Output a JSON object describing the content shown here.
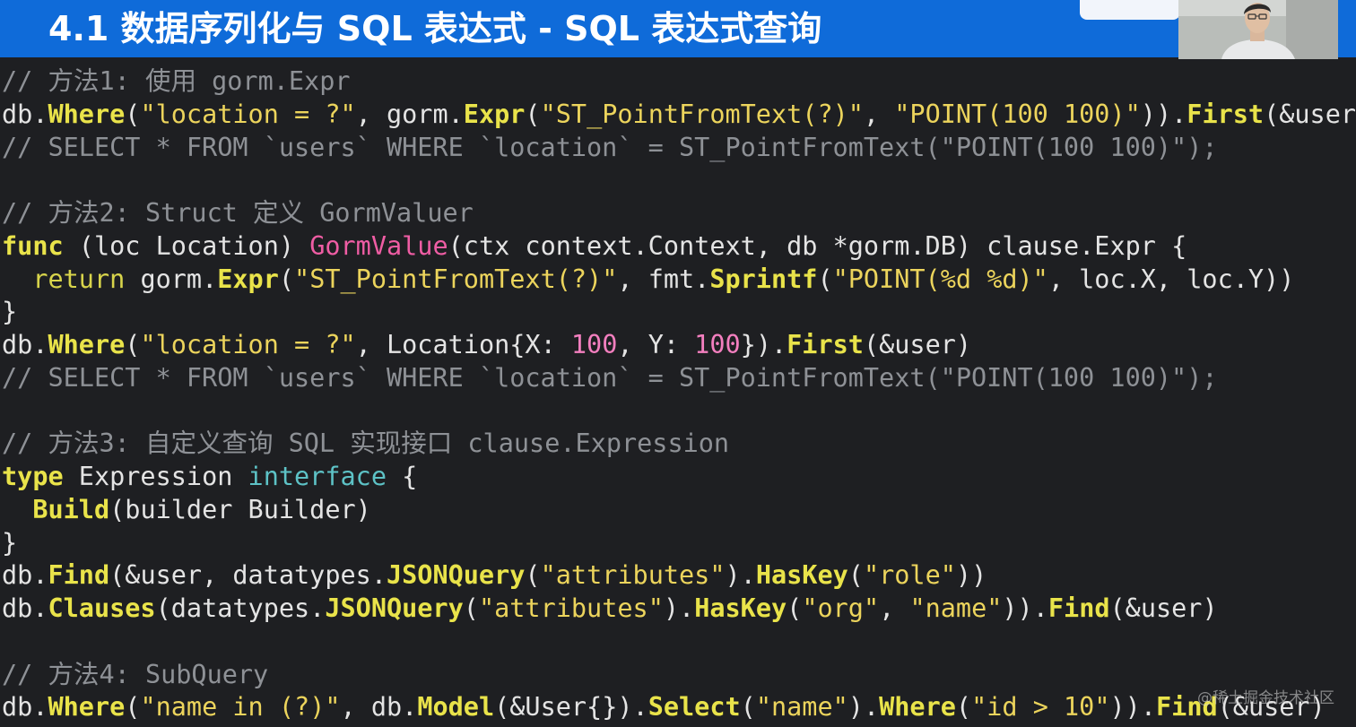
{
  "slide": {
    "title": "4.1 数据序列化与 SQL 表达式 - SQL 表达式查询"
  },
  "watermark": "@稀土掘金技术社区",
  "colors": {
    "title_bar": "#0f6bd9",
    "background": "#1e1f22",
    "comment": "#8e9196",
    "function_call": "#e9e34a",
    "string": "#ecd45c",
    "number": "#f37fbf",
    "type_keyword": "#5dc2c6",
    "method_name": "#ef5da4"
  },
  "code_lines": [
    [
      [
        "comment",
        "// 方法1: 使用 gorm.Expr"
      ]
    ],
    [
      [
        "plain",
        "db."
      ],
      [
        "call",
        "Where"
      ],
      [
        "plain",
        "("
      ],
      [
        "str",
        "\"location = ?\""
      ],
      [
        "plain",
        ", gorm."
      ],
      [
        "call",
        "Expr"
      ],
      [
        "plain",
        "("
      ],
      [
        "str",
        "\"ST_PointFromText(?)\""
      ],
      [
        "plain",
        ", "
      ],
      [
        "str",
        "\"POINT(100 100)\""
      ],
      [
        "plain",
        "))."
      ],
      [
        "call",
        "First"
      ],
      [
        "plain",
        "(&user)"
      ]
    ],
    [
      [
        "comment",
        "// SELECT * FROM `users` WHERE `location` = ST_PointFromText(\"POINT(100 100)\");"
      ]
    ],
    [],
    [
      [
        "comment",
        "// 方法2: Struct 定义 GormValuer"
      ]
    ],
    [
      [
        "keyword",
        "func"
      ],
      [
        "plain",
        " (loc Location) "
      ],
      [
        "method",
        "GormValue"
      ],
      [
        "plain",
        "(ctx context.Context, db *gorm.DB) clause.Expr {"
      ]
    ],
    [
      [
        "plain",
        "  "
      ],
      [
        "keyword2",
        "return"
      ],
      [
        "plain",
        " gorm."
      ],
      [
        "call",
        "Expr"
      ],
      [
        "plain",
        "("
      ],
      [
        "str",
        "\"ST_PointFromText(?)\""
      ],
      [
        "plain",
        ", fmt."
      ],
      [
        "call",
        "Sprintf"
      ],
      [
        "plain",
        "("
      ],
      [
        "str",
        "\"POINT(%d %d)\""
      ],
      [
        "plain",
        ", loc.X, loc.Y))"
      ]
    ],
    [
      [
        "plain",
        "}"
      ]
    ],
    [
      [
        "plain",
        "db."
      ],
      [
        "call",
        "Where"
      ],
      [
        "plain",
        "("
      ],
      [
        "str",
        "\"location = ?\""
      ],
      [
        "plain",
        ", Location{X: "
      ],
      [
        "num",
        "100"
      ],
      [
        "plain",
        ", Y: "
      ],
      [
        "num",
        "100"
      ],
      [
        "plain",
        "})."
      ],
      [
        "call",
        "First"
      ],
      [
        "plain",
        "(&user)"
      ]
    ],
    [
      [
        "comment",
        "// SELECT * FROM `users` WHERE `location` = ST_PointFromText(\"POINT(100 100)\");"
      ]
    ],
    [],
    [
      [
        "comment",
        "// 方法3: 自定义查询 SQL 实现接口 clause.Expression"
      ]
    ],
    [
      [
        "keyword",
        "type"
      ],
      [
        "plain",
        " Expression "
      ],
      [
        "type",
        "interface"
      ],
      [
        "plain",
        " {"
      ]
    ],
    [
      [
        "plain",
        "  "
      ],
      [
        "call",
        "Build"
      ],
      [
        "plain",
        "(builder Builder)"
      ]
    ],
    [
      [
        "plain",
        "}"
      ]
    ],
    [
      [
        "plain",
        "db."
      ],
      [
        "call",
        "Find"
      ],
      [
        "plain",
        "(&user, datatypes."
      ],
      [
        "call",
        "JSONQuery"
      ],
      [
        "plain",
        "("
      ],
      [
        "str",
        "\"attributes\""
      ],
      [
        "plain",
        ")."
      ],
      [
        "call",
        "HasKey"
      ],
      [
        "plain",
        "("
      ],
      [
        "str",
        "\"role\""
      ],
      [
        "plain",
        "))"
      ]
    ],
    [
      [
        "plain",
        "db."
      ],
      [
        "call",
        "Clauses"
      ],
      [
        "plain",
        "(datatypes."
      ],
      [
        "call",
        "JSONQuery"
      ],
      [
        "plain",
        "("
      ],
      [
        "str",
        "\"attributes\""
      ],
      [
        "plain",
        ")."
      ],
      [
        "call",
        "HasKey"
      ],
      [
        "plain",
        "("
      ],
      [
        "str",
        "\"org\""
      ],
      [
        "plain",
        ", "
      ],
      [
        "str",
        "\"name\""
      ],
      [
        "plain",
        "))."
      ],
      [
        "call",
        "Find"
      ],
      [
        "plain",
        "(&user)"
      ]
    ],
    [],
    [
      [
        "comment",
        "// 方法4: SubQuery"
      ]
    ],
    [
      [
        "plain",
        "db."
      ],
      [
        "call",
        "Where"
      ],
      [
        "plain",
        "("
      ],
      [
        "str",
        "\"name in (?)\""
      ],
      [
        "plain",
        ", db."
      ],
      [
        "call",
        "Model"
      ],
      [
        "plain",
        "(&User{})."
      ],
      [
        "call",
        "Select"
      ],
      [
        "plain",
        "("
      ],
      [
        "str",
        "\"name\""
      ],
      [
        "plain",
        ")."
      ],
      [
        "call",
        "Where"
      ],
      [
        "plain",
        "("
      ],
      [
        "str",
        "\"id > 10\""
      ],
      [
        "plain",
        "))."
      ],
      [
        "call",
        "Find"
      ],
      [
        "plain",
        "(&user)"
      ]
    ]
  ]
}
